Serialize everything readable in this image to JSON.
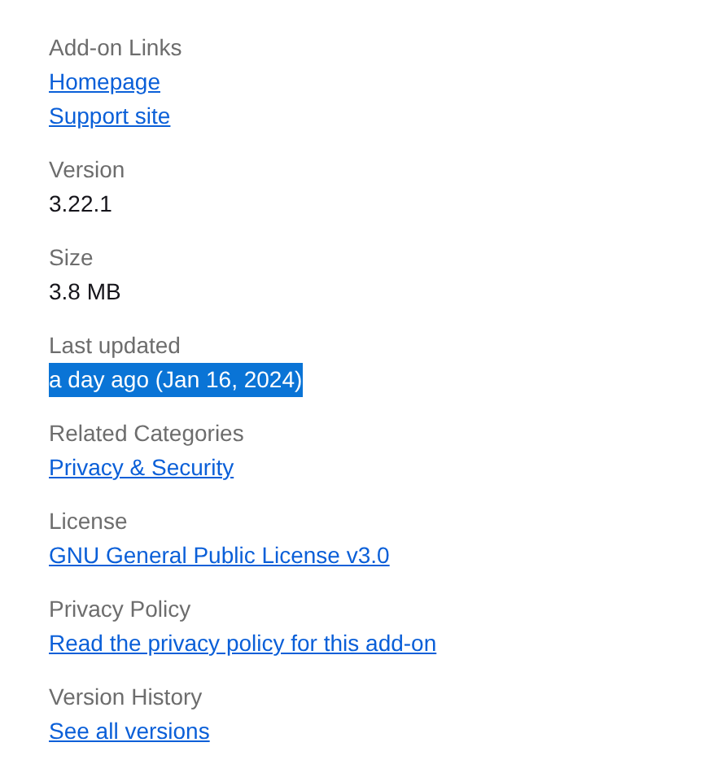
{
  "sections": [
    {
      "label": "Add-on Links",
      "items": [
        {
          "kind": "link",
          "text": "Homepage",
          "highlighted": false
        },
        {
          "kind": "link",
          "text": "Support site",
          "highlighted": false
        }
      ]
    },
    {
      "label": "Version",
      "items": [
        {
          "kind": "text",
          "text": "3.22.1",
          "highlighted": false
        }
      ]
    },
    {
      "label": "Size",
      "items": [
        {
          "kind": "text",
          "text": "3.8 MB",
          "highlighted": false
        }
      ]
    },
    {
      "label": "Last updated",
      "items": [
        {
          "kind": "text",
          "text": "a day ago (Jan 16, 2024)",
          "highlighted": true
        }
      ]
    },
    {
      "label": "Related Categories",
      "items": [
        {
          "kind": "link",
          "text": "Privacy & Security",
          "highlighted": false
        }
      ]
    },
    {
      "label": "License",
      "items": [
        {
          "kind": "link",
          "text": "GNU General Public License v3.0",
          "highlighted": false
        }
      ]
    },
    {
      "label": "Privacy Policy",
      "items": [
        {
          "kind": "link",
          "text": "Read the privacy policy for this add-on",
          "highlighted": false
        }
      ]
    },
    {
      "label": "Version History",
      "items": [
        {
          "kind": "link",
          "text": "See all versions",
          "highlighted": false
        }
      ]
    }
  ]
}
